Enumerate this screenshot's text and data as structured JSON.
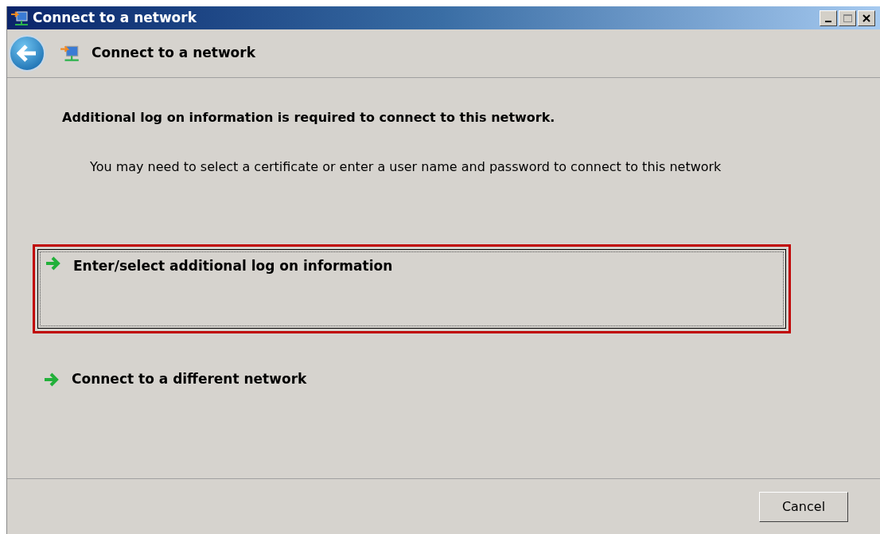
{
  "window": {
    "title": "Connect to a network"
  },
  "header": {
    "title": "Connect to a network"
  },
  "heading": "Additional log on information is required to connect to this network.",
  "description": "You may need to select a certificate or enter a user name and password to connect to this network",
  "options": [
    {
      "label": "Enter/select additional log on information",
      "selected": true
    },
    {
      "label": "Connect to a different network",
      "selected": false
    }
  ],
  "buttons": [
    "Cancel"
  ]
}
